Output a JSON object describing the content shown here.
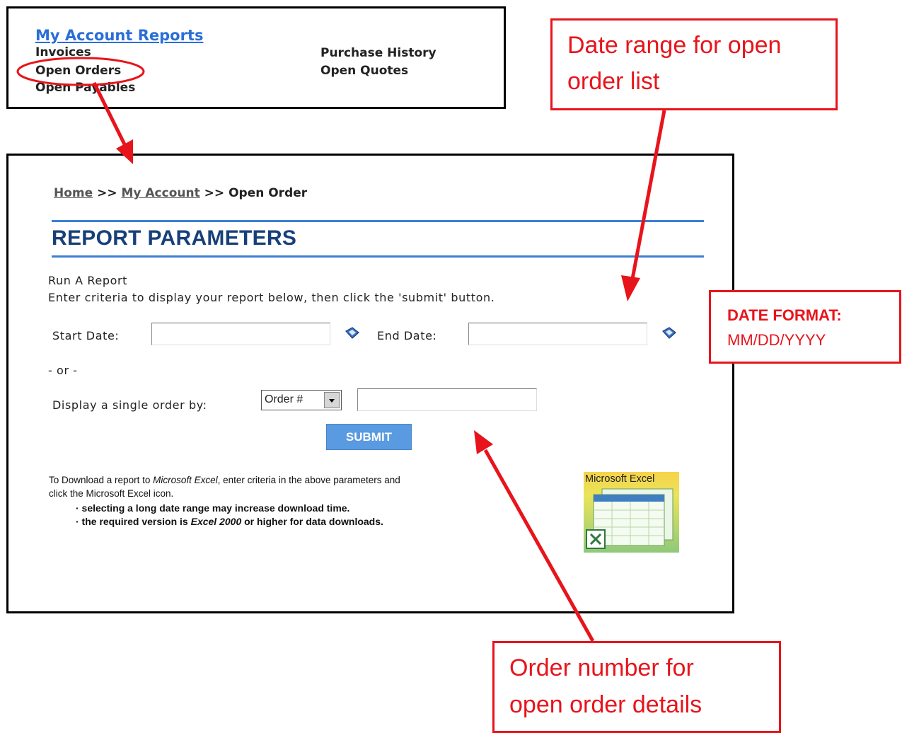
{
  "menu": {
    "title": "My Account Reports",
    "items": {
      "invoices": "Invoices",
      "open_orders": "Open Orders",
      "open_payables": "Open Payables",
      "purchase_history": "Purchase History",
      "open_quotes": "Open Quotes"
    }
  },
  "breadcrumb": {
    "home": "Home",
    "sep1": " >> ",
    "account": "My Account",
    "sep2": " >> ",
    "current": "Open Order"
  },
  "report": {
    "title": "REPORT PARAMETERS",
    "heading": "Run A Report",
    "instructions": "Enter criteria to display your report below, then click the 'submit' button.",
    "start_label": "Start Date:",
    "start_value": "",
    "end_label": "End Date:",
    "end_value": "",
    "or_text": "- or -",
    "single_label": "Display a single order by:",
    "select_value": "Order #",
    "order_value": "",
    "submit_label": "SUBMIT"
  },
  "download": {
    "line1_a": "To Download",
    "line1_b": " a report to ",
    "line1_c": "Microsoft Excel",
    "line1_d": ", enter criteria in the above parameters and",
    "line2": "click the Microsoft Excel icon.",
    "bullet1": "· selecting a long date range may increase download time.",
    "bullet2_a": "· the required version is ",
    "bullet2_b": "Excel 2000",
    "bullet2_c": " or higher for data downloads.",
    "excel_label": "Microsoft Excel"
  },
  "callouts": {
    "date_range_1": "Date range for open",
    "date_range_2": "order list",
    "format_title": "DATE FORMAT:",
    "format_value": "MM/DD/YYYY",
    "order_num_1": "Order number for",
    "order_num_2": "open order details"
  },
  "colors": {
    "callout_red": "#e8141b",
    "link_blue": "#2a6fd6",
    "heading_navy": "#17407a",
    "rule_blue": "#3b7fd2",
    "button_blue": "#5a9ae0"
  }
}
